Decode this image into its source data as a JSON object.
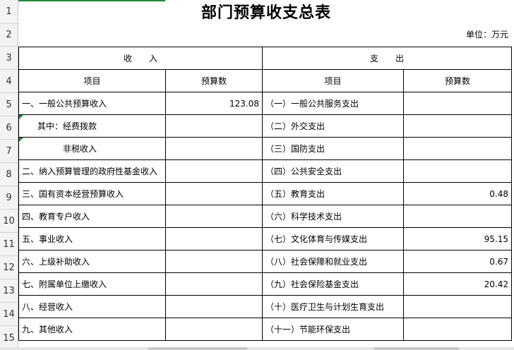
{
  "title": "部门预算收支总表",
  "unit": "单位：万元",
  "row_numbers": [
    "1",
    "2",
    "3",
    "4",
    "5",
    "6",
    "7",
    "8",
    "9",
    "10",
    "11",
    "12",
    "13",
    "14",
    "15"
  ],
  "section_headers": {
    "income": "收　　入",
    "expense": "支　　出"
  },
  "column_headers": {
    "income_item": "项目",
    "income_budget": "预算数",
    "expense_item": "项目",
    "expense_budget": "预算数"
  },
  "rows": [
    {
      "income_item": "一、一般公共预算收入",
      "income_budget": "123.08",
      "expense_item": "（一）一般公共服务支出",
      "expense_budget": ""
    },
    {
      "income_item": "其中：经费拨款",
      "income_budget": "",
      "expense_item": "（二）外交支出",
      "expense_budget": ""
    },
    {
      "income_item": "非税收入",
      "income_budget": "",
      "expense_item": "（三）国防支出",
      "expense_budget": ""
    },
    {
      "income_item": "二、纳入预算管理的政府性基金收入",
      "income_budget": "",
      "expense_item": "（四）公共安全支出",
      "expense_budget": ""
    },
    {
      "income_item": "三、国有资本经营预算收入",
      "income_budget": "",
      "expense_item": "（五）教育支出",
      "expense_budget": "0.48"
    },
    {
      "income_item": "四、教育专户收入",
      "income_budget": "",
      "expense_item": "（六）科学技术支出",
      "expense_budget": ""
    },
    {
      "income_item": "五、事业收入",
      "income_budget": "",
      "expense_item": "（七）文化体育与传媒支出",
      "expense_budget": "95.15"
    },
    {
      "income_item": "六、上级补助收入",
      "income_budget": "",
      "expense_item": "（八）社会保障和就业支出",
      "expense_budget": "0.67"
    },
    {
      "income_item": "七、附属单位上缴收入",
      "income_budget": "",
      "expense_item": "（九）社会保险基金支出",
      "expense_budget": "20.42"
    },
    {
      "income_item": "八、经营收入",
      "income_budget": "",
      "expense_item": "（十）医疗卫生与计划生育支出",
      "expense_budget": ""
    },
    {
      "income_item": "九、其他收入",
      "income_budget": "",
      "expense_item": "（十一）节能环保支出",
      "expense_budget": ""
    }
  ]
}
